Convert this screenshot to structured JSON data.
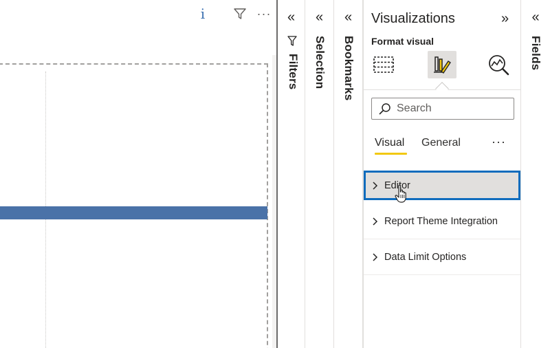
{
  "canvas": {
    "header_icons": {
      "info": "i",
      "filter": "filter-icon",
      "more": "···"
    }
  },
  "panes": {
    "filters": {
      "collapse": "«",
      "label": "Filters"
    },
    "selection": {
      "collapse": "«",
      "label": "Selection"
    },
    "bookmarks": {
      "collapse": "«",
      "label": "Bookmarks"
    },
    "fields": {
      "collapse": "«",
      "label": "Fields"
    }
  },
  "visualizations": {
    "title": "Visualizations",
    "expand": "»",
    "format_label": "Format visual",
    "icons": [
      "build-visual-icon",
      "format-visual-icon",
      "analytics-icon"
    ],
    "search": {
      "placeholder": "Search",
      "value": ""
    },
    "tabs": [
      {
        "label": "Visual",
        "active": true
      },
      {
        "label": "General",
        "active": false
      }
    ],
    "tabs_more": "···",
    "cards": [
      {
        "label": "Editor",
        "selected": true
      },
      {
        "label": "Report Theme Integration",
        "selected": false
      },
      {
        "label": "Data Limit Options",
        "selected": false
      }
    ]
  },
  "colors": {
    "accent_yellow": "#f2c811",
    "selection_blue": "#0f6cbd",
    "bar_blue": "#4a72a8"
  }
}
